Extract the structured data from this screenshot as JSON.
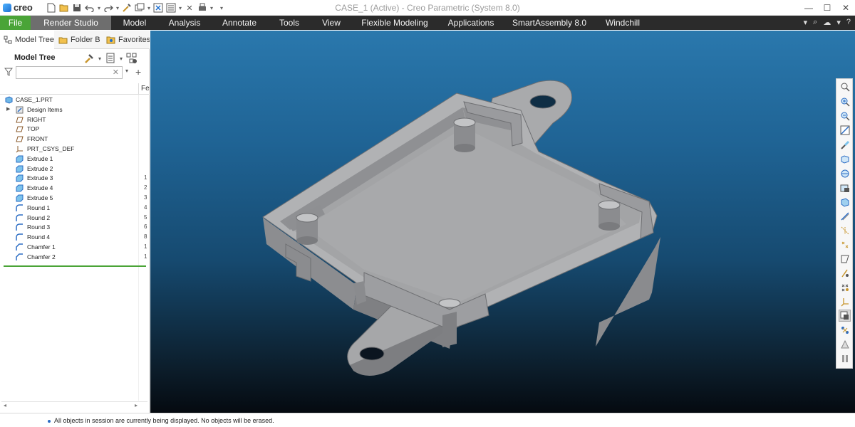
{
  "app": {
    "logo_text": "creo",
    "window_title": "CASE_1 (Active) - Creo Parametric (System 8.0)"
  },
  "colors": {
    "file_tab": "#4aa437",
    "active_tab": "#6e6e6e",
    "ribbon_bg": "#2b2b2b",
    "viewport_top": "#2a78ad",
    "viewport_bottom": "#050a10",
    "part_face": "#a9aaac",
    "insert_marker": "#4aa437"
  },
  "quick_access": [
    "new-icon",
    "open-icon",
    "save-icon",
    "undo-icon",
    "redo-icon",
    "regenerate-icon",
    "windows-icon",
    "close-window-icon",
    "customize-icon"
  ],
  "ribbon": {
    "tabs": [
      {
        "label": "File"
      },
      {
        "label": "Render Studio"
      },
      {
        "label": "Model"
      },
      {
        "label": "Analysis"
      },
      {
        "label": "Annotate"
      },
      {
        "label": "Tools"
      },
      {
        "label": "View"
      },
      {
        "label": "Flexible Modeling"
      },
      {
        "label": "Applications"
      },
      {
        "label": "SmartAssembly 8.0"
      },
      {
        "label": "Windchill"
      }
    ],
    "active_tab": "Render Studio"
  },
  "nav": {
    "tabs": [
      {
        "label": "Model Tree"
      },
      {
        "label": "Folder B"
      },
      {
        "label": "Favorites"
      }
    ]
  },
  "model_tree": {
    "title": "Model Tree",
    "search_placeholder": "",
    "column_header": "Fe",
    "items": [
      {
        "label": "CASE_1.PRT",
        "icon": "part-icon",
        "num": ""
      },
      {
        "label": "Design Items",
        "icon": "design-items-icon",
        "num": ""
      },
      {
        "label": "RIGHT",
        "icon": "datum-plane-icon",
        "num": ""
      },
      {
        "label": "TOP",
        "icon": "datum-plane-icon",
        "num": ""
      },
      {
        "label": "FRONT",
        "icon": "datum-plane-icon",
        "num": ""
      },
      {
        "label": "PRT_CSYS_DEF",
        "icon": "csys-icon",
        "num": ""
      },
      {
        "label": "Extrude 1",
        "icon": "extrude-icon",
        "num": ""
      },
      {
        "label": "Extrude 2",
        "icon": "extrude-icon",
        "num": ""
      },
      {
        "label": "Extrude 3",
        "icon": "extrude-icon",
        "num": "1"
      },
      {
        "label": "Extrude 4",
        "icon": "extrude-icon",
        "num": "2"
      },
      {
        "label": "Extrude 5",
        "icon": "extrude-icon",
        "num": "3"
      },
      {
        "label": "Round 1",
        "icon": "round-icon",
        "num": "4"
      },
      {
        "label": "Round 2",
        "icon": "round-icon",
        "num": "5"
      },
      {
        "label": "Round 3",
        "icon": "round-icon",
        "num": "6"
      },
      {
        "label": "Round 4",
        "icon": "round-icon",
        "num": "8"
      },
      {
        "label": "Chamfer 1",
        "icon": "chamfer-icon",
        "num": "1"
      },
      {
        "label": "Chamfer 2",
        "icon": "chamfer-icon",
        "num": "1"
      }
    ]
  },
  "view_toolbar": [
    "refit-icon",
    "zoom-in-icon",
    "zoom-out-icon",
    "repaint-icon",
    "display-style-icon",
    "saved-orientations-icon",
    "named-views-icon",
    "view-manager-icon",
    "perspective-icon",
    "plane-display-icon",
    "axis-display-icon",
    "point-display-icon",
    "csys-display-icon",
    "annotation-display-icon",
    "spin-center-icon",
    "section-icon",
    "appearance-icon",
    "pause-icon",
    "render-icon"
  ],
  "status": {
    "message": "All objects in session are currently being displayed. No objects will be erased."
  }
}
